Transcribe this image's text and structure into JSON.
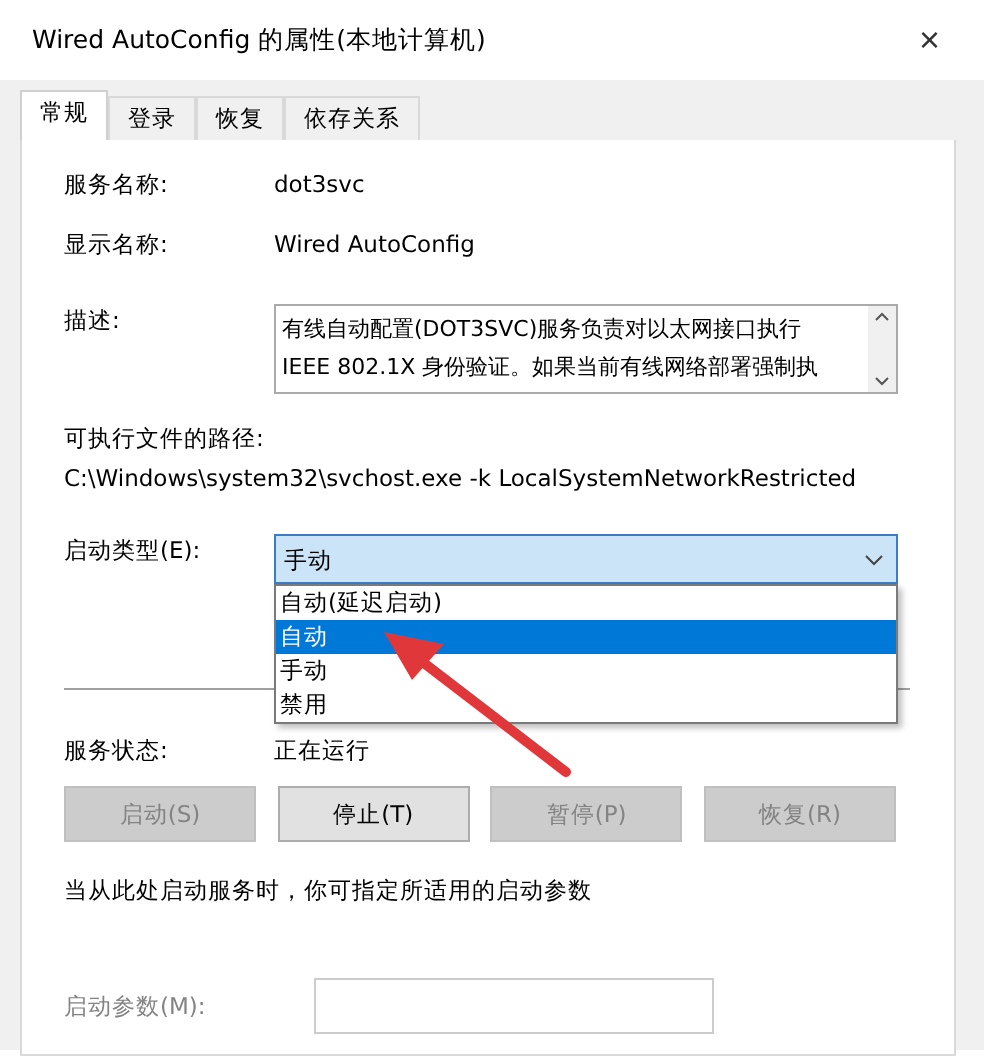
{
  "window": {
    "title": "Wired AutoConfig 的属性(本地计算机)",
    "close": "×"
  },
  "tabs": [
    {
      "label": "常规",
      "selected": true
    },
    {
      "label": "登录",
      "selected": false
    },
    {
      "label": "恢复",
      "selected": false
    },
    {
      "label": "依存关系",
      "selected": false
    }
  ],
  "fields": [
    {
      "label": "服务名称:",
      "value": "dot3svc"
    },
    {
      "label": "显示名称:",
      "value": "Wired AutoConfig"
    }
  ],
  "description": {
    "label": "描述:",
    "lines": [
      "有线自动配置(DOT3SVC)服务负责对以太网接口执行",
      "IEEE 802.1X 身份验证。如果当前有线网络部署强制执"
    ]
  },
  "path": {
    "label": "可执行文件的路径:",
    "value": "C:\\Windows\\system32\\svchost.exe -k LocalSystemNetworkRestricted"
  },
  "startup_type": {
    "label": "启动类型(E):",
    "value": "手动",
    "expanded": true,
    "options": [
      {
        "label": "自动(延迟启动)",
        "highlighted": false
      },
      {
        "label": "自动",
        "highlighted": true
      },
      {
        "label": "手动",
        "highlighted": false
      },
      {
        "label": "禁用",
        "highlighted": false
      }
    ]
  },
  "service_status": {
    "label": "服务状态:",
    "value": "正在运行"
  },
  "buttons": [
    {
      "label": "启动(S)",
      "disabled": true
    },
    {
      "label": "停止(T)",
      "disabled": false
    },
    {
      "label": "暂停(P)",
      "disabled": true
    },
    {
      "label": "恢复(R)",
      "disabled": true
    }
  ],
  "hint": "当从此处启动服务时，你可指定所适用的启动参数",
  "parameters": {
    "label": "启动参数(M):",
    "disabled": true
  },
  "annotation": {
    "kind": "arrow"
  }
}
